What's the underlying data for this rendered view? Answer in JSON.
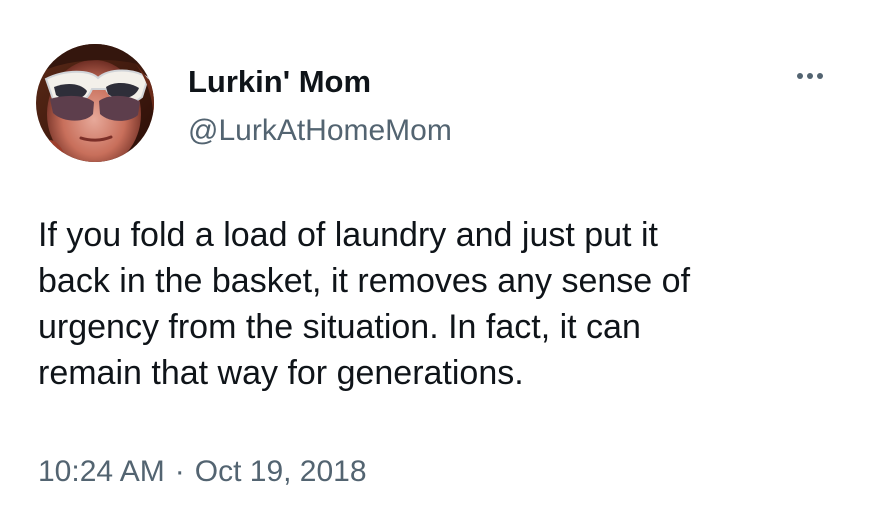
{
  "tweet": {
    "author": {
      "display_name": "Lurkin' Mom",
      "handle": "@LurkAtHomeMom",
      "avatar_icon": "profile-avatar"
    },
    "more_icon": "more-options-icon",
    "text_lines": [
      "If you fold a load of laundry and just put it",
      "back in the basket, it removes any sense of",
      "urgency from the situation. In fact, it can",
      "remain that way for generations."
    ],
    "timestamp": {
      "time": "10:24 AM",
      "separator": "·",
      "date": "Oct 19, 2018"
    }
  },
  "colors": {
    "background": "#ffffff",
    "primary_text": "#0f1419",
    "secondary_text": "#536471"
  }
}
